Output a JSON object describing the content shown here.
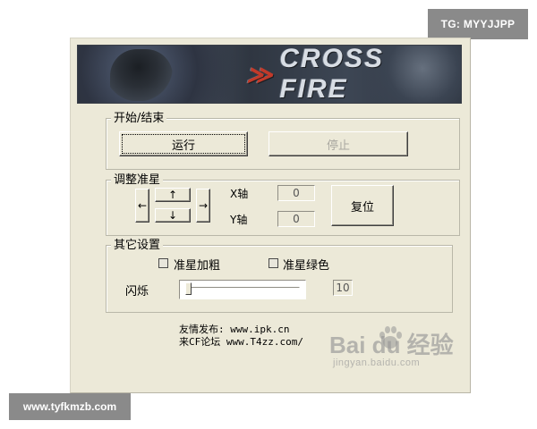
{
  "watermark_top": "TG: MYYJJPP",
  "watermark_bottom": "www.tyfkmzb.com",
  "banner": {
    "logo": "CROSS FIRE",
    "logo_icon": "cf-logo-icon"
  },
  "start_stop": {
    "group_label": "开始/结束",
    "run_label": "运行",
    "stop_label": "停止"
  },
  "crosshair": {
    "group_label": "调整准星",
    "up_arrow": "↑",
    "down_arrow": "↓",
    "left_arrow": "←",
    "right_arrow": "→",
    "x_label": "X轴",
    "x_value": "0",
    "y_label": "Y轴",
    "y_value": "0",
    "reset_label": "复位"
  },
  "other": {
    "group_label": "其它设置",
    "bold_label": "准星加粗",
    "green_label": "准星绿色",
    "flash_label": "闪烁",
    "flash_value": "10",
    "flash_level": 0
  },
  "credits": {
    "line1": "友情发布: www.ipk.cn",
    "line2": "来CF论坛 www.T4zz.com/"
  },
  "baidu_watermark": {
    "brand": "Bai du 经验",
    "url": "jingyan.baidu.com"
  }
}
